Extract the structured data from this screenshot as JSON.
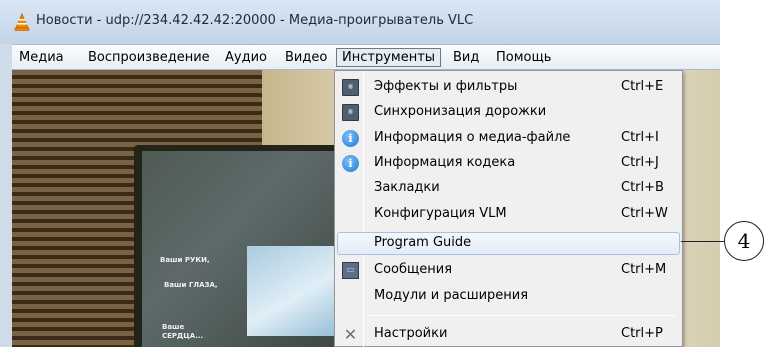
{
  "window": {
    "title": "Новости - udp://234.42.42.42:20000 - Медиа-проигрыватель VLC"
  },
  "menubar": {
    "items": [
      {
        "label": "Медиа"
      },
      {
        "label": "Воспроизведение"
      },
      {
        "label": "Аудио"
      },
      {
        "label": "Видео"
      },
      {
        "label": "Инструменты"
      },
      {
        "label": "Вид"
      },
      {
        "label": "Помощь"
      }
    ]
  },
  "video": {
    "overlay_texts": [
      "Ваши РУКИ,",
      "Ваши ГЛАЗА,",
      "Ваше",
      "СЕРДЦА..."
    ]
  },
  "tools_menu": {
    "items": [
      {
        "label": "Эффекты и фильтры",
        "shortcut": "Ctrl+E",
        "icon": "tools-icon"
      },
      {
        "label": "Синхронизация дорожки",
        "shortcut": "",
        "icon": "tools-icon"
      },
      {
        "label": "Информация о медиа-файле",
        "shortcut": "Ctrl+I",
        "icon": "info-icon"
      },
      {
        "label": "Информация кодека",
        "shortcut": "Ctrl+J",
        "icon": "info-icon"
      },
      {
        "label": "Закладки",
        "shortcut": "Ctrl+B",
        "icon": ""
      },
      {
        "label": "Конфигурация VLM",
        "shortcut": "Ctrl+W",
        "icon": ""
      },
      {
        "label": "Program Guide",
        "shortcut": "",
        "icon": ""
      },
      {
        "label": "Сообщения",
        "shortcut": "Ctrl+M",
        "icon": "messages-icon"
      },
      {
        "label": "Модули и расширения",
        "shortcut": "",
        "icon": ""
      },
      {
        "label": "Настройки",
        "shortcut": "Ctrl+P",
        "icon": "settings-icon"
      }
    ]
  },
  "callout": {
    "number": "4"
  },
  "colors": {
    "menu_highlight_border": "#a8c1e2",
    "vlc_orange": "#f08a00"
  }
}
